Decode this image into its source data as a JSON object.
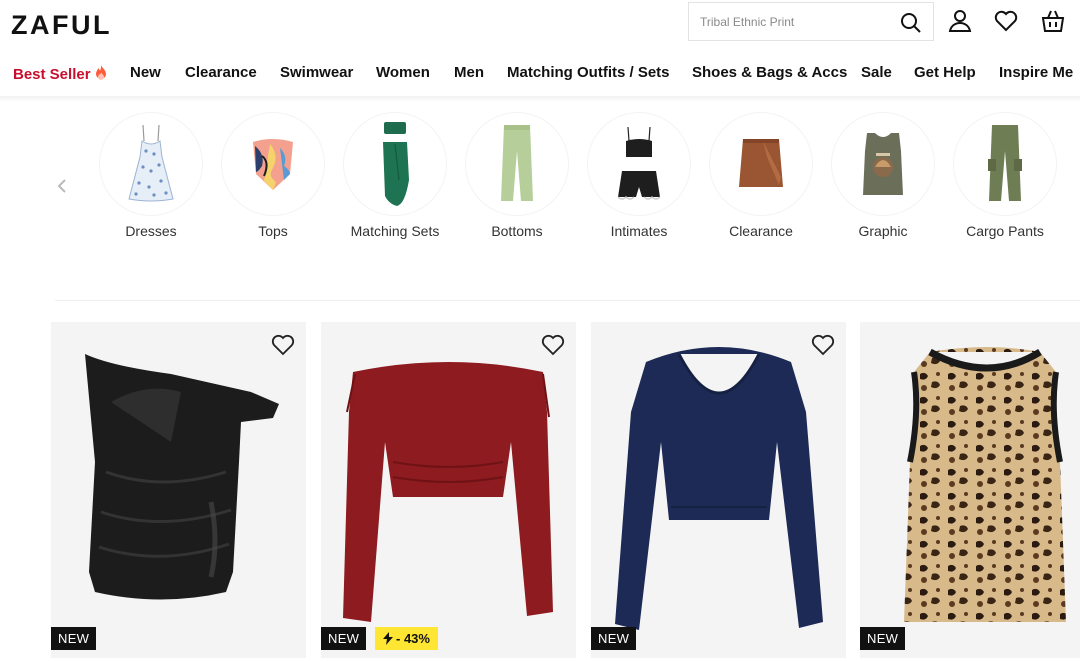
{
  "header": {
    "logo": "ZAFUL",
    "search_placeholder": "Tribal Ethnic Print",
    "icons": [
      "search-icon",
      "account-icon",
      "heart-icon",
      "bag-icon"
    ]
  },
  "nav": {
    "items": [
      {
        "label": "Best Seller"
      },
      {
        "label": "New"
      },
      {
        "label": "Clearance"
      },
      {
        "label": "Swimwear"
      },
      {
        "label": "Women"
      },
      {
        "label": "Men"
      },
      {
        "label": "Matching Outfits / Sets"
      },
      {
        "label": "Shoes & Bags & Accs"
      },
      {
        "label": "Sale"
      },
      {
        "label": "Get Help"
      },
      {
        "label": "Inspire Me"
      }
    ]
  },
  "categories": {
    "items": [
      {
        "label": "Dresses"
      },
      {
        "label": "Tops"
      },
      {
        "label": "Matching Sets"
      },
      {
        "label": "Bottoms"
      },
      {
        "label": "Intimates"
      },
      {
        "label": "Clearance"
      },
      {
        "label": "Graphic"
      },
      {
        "label": "Cargo Pants"
      }
    ]
  },
  "products": [
    {
      "badge": "NEW",
      "sale": "",
      "image": "black-one-shoulder-leather-top"
    },
    {
      "badge": "NEW",
      "sale": "- 43%",
      "image": "red-off-shoulder-top"
    },
    {
      "badge": "NEW",
      "sale": "",
      "image": "navy-v-neck-sweater"
    },
    {
      "badge": "NEW",
      "sale": "",
      "image": "leopard-sequin-tank"
    }
  ],
  "colors": {
    "accent": "#c8102e",
    "sale_badge": "#ffe633",
    "new_badge": "#111111"
  }
}
